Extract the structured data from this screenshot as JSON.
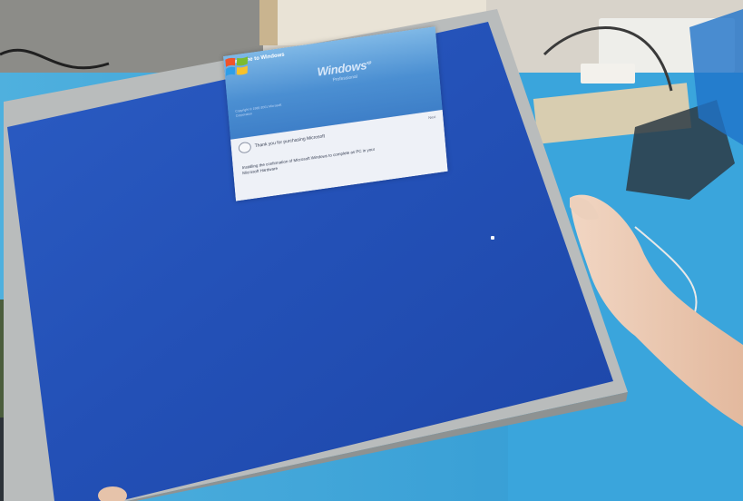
{
  "scene": {
    "description_hidden": "",
    "colors": {
      "table": "#3aa0d6",
      "screen": "#2654b8",
      "bezel": "#b7b9b9",
      "background_wall": "#d9d4cb"
    }
  },
  "welcome_dialog": {
    "title": "Welcome to Windows",
    "brand": "Windows",
    "brand_mark": "xp",
    "brand_sub": "Professional",
    "left_text": "Copyright © 1985-2001 Microsoft Corporation",
    "status_line": "Thank you for purchasing Microsoft",
    "body_text": "Installing the confirmation of Microsoft Windows to complete as PC in your Microsoft Hardware",
    "corner": "Next"
  }
}
